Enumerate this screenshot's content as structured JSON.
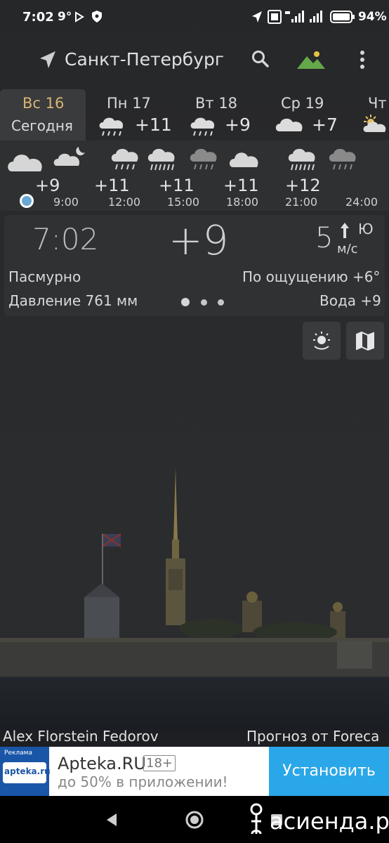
{
  "status_bar": {
    "time": "7:02",
    "temp": "9°",
    "battery": "94%"
  },
  "top_bar": {
    "city": "Санкт-Петербург"
  },
  "days": [
    {
      "name": "Вс 16",
      "sub": "Сегодня",
      "temp": ""
    },
    {
      "name": "Пн 17",
      "temp": "+11"
    },
    {
      "name": "Вт 18",
      "temp": "+9"
    },
    {
      "name": "Ср 19",
      "temp": "+7"
    },
    {
      "name": "Чт",
      "temp": ""
    }
  ],
  "hourly": {
    "temps": [
      "+9",
      "+11",
      "+11",
      "+11",
      "+12"
    ],
    "times": [
      "9:00",
      "12:00",
      "15:00",
      "18:00",
      "21:00",
      "24:00"
    ]
  },
  "current": {
    "time": "7:02",
    "temp": "+9",
    "wind_speed": "5",
    "wind_dir": "Ю",
    "wind_unit": "м/с",
    "condition": "Пасмурно",
    "feels_like": "По ощущению +6°",
    "pressure": "Давление 761 мм",
    "water": "Вода +9"
  },
  "credits": {
    "photo": "Alex Florstein Fedorov",
    "forecast": "Прогноз от Foreca"
  },
  "ad": {
    "label": "Реклама",
    "logo_text": "apteka.ru",
    "title": "Apteka.RU",
    "badge": "18+",
    "subtitle": "до 50% в приложении!",
    "cta": "Установить"
  },
  "watermark": "асиенда.ру",
  "colors": {
    "today_accent": "#d9b377",
    "ad_cta": "#2aa7e8",
    "background": "#262729"
  }
}
